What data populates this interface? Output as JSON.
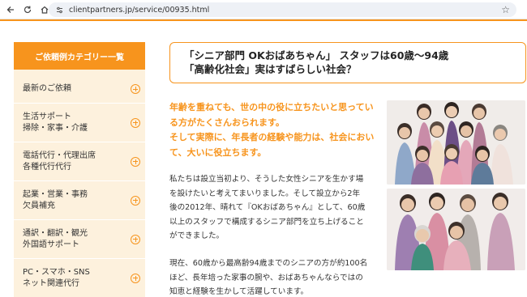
{
  "browser": {
    "url": "clientpartners.jp/service/00935.html",
    "back_icon": "arrow-back-icon",
    "reload_icon": "reload-icon",
    "home_icon": "home-icon",
    "site_info_icon": "site-info-icon",
    "bookmark_icon": "star-icon"
  },
  "sidebar": {
    "heading": "ご依頼例カテゴリー一覧",
    "items": [
      {
        "label": "最新のご依頼"
      },
      {
        "label": "生活サポート\n掃除・家事・介護"
      },
      {
        "label": "電話代行・代理出席\n各種代行代行"
      },
      {
        "label": "起業・営業・事務\n欠員補充"
      },
      {
        "label": "通訳・翻訳・観光\n外国語サポート"
      },
      {
        "label": "PC・スマホ・SNS\nネット関連代行"
      }
    ]
  },
  "main": {
    "title_line1": "「シニア部門 OKおばあちゃん」 スタッフは60歳〜94歳",
    "title_line2": "「高齢化社会」実はすばらしい社会？",
    "lead": [
      "年齢を重ねても、世の中の役に立ちたいと思ってい",
      "る方がたくさんおられます。",
      "そして実際に、年長者の経験や能力は、社会におい",
      "て、大いに役立ちます。"
    ],
    "paragraph1": [
      "私たちは設立当初より、そうした女性シニアを生かす場",
      "を設けたいと考えてまいりました。そして設立から2年",
      "後の2012年、晴れて『OKおばあちゃん』として、60歳",
      "以上のスタッフで構成するシニア部門を立ち上げること",
      "ができました。"
    ],
    "paragraph2": [
      "現在、60歳から最高齢94歳までのシニアの方が約100名",
      "ほど、長年培った家事の腕や、おばあちゃんならではの",
      "知恵と経験を生かして活躍しています。"
    ]
  },
  "colors": {
    "accent": "#f7941d",
    "sidebar_bg": "#fdf1dd",
    "text": "#333333"
  }
}
